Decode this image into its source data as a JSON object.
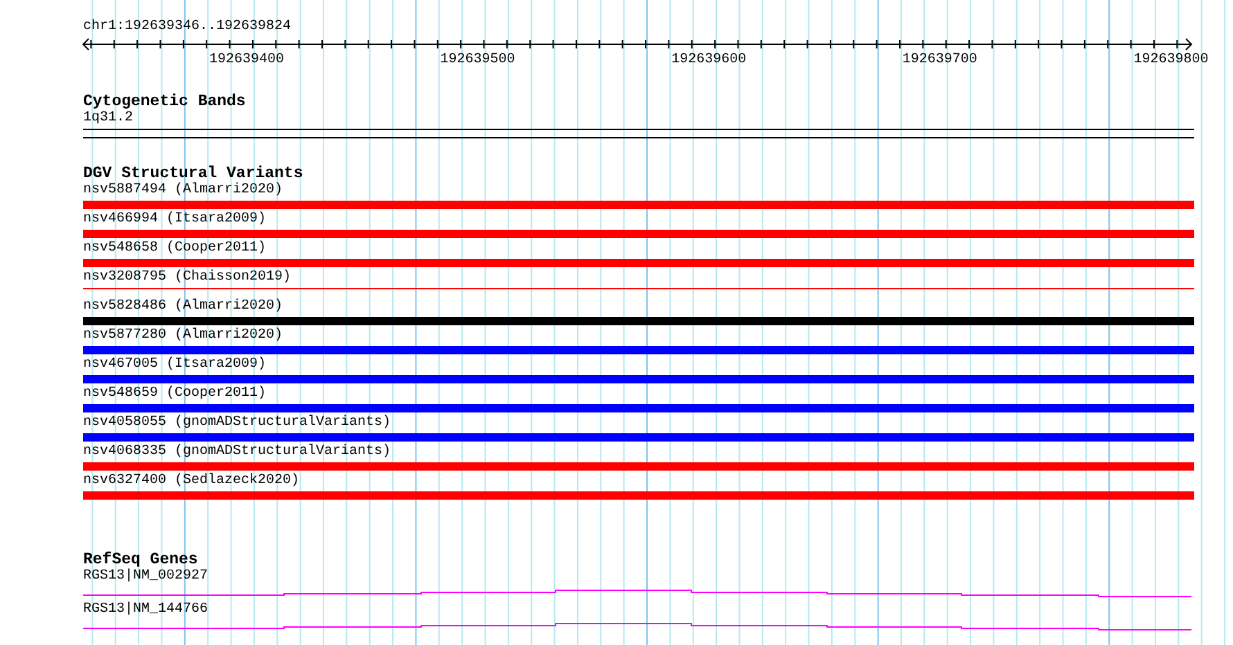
{
  "location": "chr1:192639346..192639824",
  "ruler": {
    "labels": [
      "192639400",
      "192639500",
      "192639600",
      "192639700",
      "192639800"
    ]
  },
  "cytogenetic_bands": {
    "title": "Cytogenetic Bands",
    "band": "1q31.2"
  },
  "dgv": {
    "title": "DGV Structural Variants",
    "variants": [
      {
        "label": "nsv5887494 (Almarri2020)",
        "color": "#ff0000",
        "kind": "thick"
      },
      {
        "label": "nsv466994 (Itsara2009)",
        "color": "#ff0000",
        "kind": "thick"
      },
      {
        "label": "nsv548658 (Cooper2011)",
        "color": "#ff0000",
        "kind": "thick"
      },
      {
        "label": "nsv3208795 (Chaisson2019)",
        "color": "#ff0000",
        "kind": "thin"
      },
      {
        "label": "nsv5828486 (Almarri2020)",
        "color": "#000000",
        "kind": "thick"
      },
      {
        "label": "nsv5877280 (Almarri2020)",
        "color": "#0000ff",
        "kind": "thick"
      },
      {
        "label": "nsv467005 (Itsara2009)",
        "color": "#0000ff",
        "kind": "thick"
      },
      {
        "label": "nsv548659 (Cooper2011)",
        "color": "#0000ff",
        "kind": "thick"
      },
      {
        "label": "nsv4058055 (gnomADStructuralVariants)",
        "color": "#0000ff",
        "kind": "thick"
      },
      {
        "label": "nsv4068335 (gnomADStructuralVariants)",
        "color": "#ff0000",
        "kind": "thick"
      },
      {
        "label": "nsv6327400 (Sedlazeck2020)",
        "color": "#ff0000",
        "kind": "thick"
      }
    ]
  },
  "refseq": {
    "title": "RefSeq Genes",
    "transcripts": [
      {
        "label": "RGS13|NM_002927"
      },
      {
        "label": "RGS13|NM_144766"
      }
    ]
  }
}
